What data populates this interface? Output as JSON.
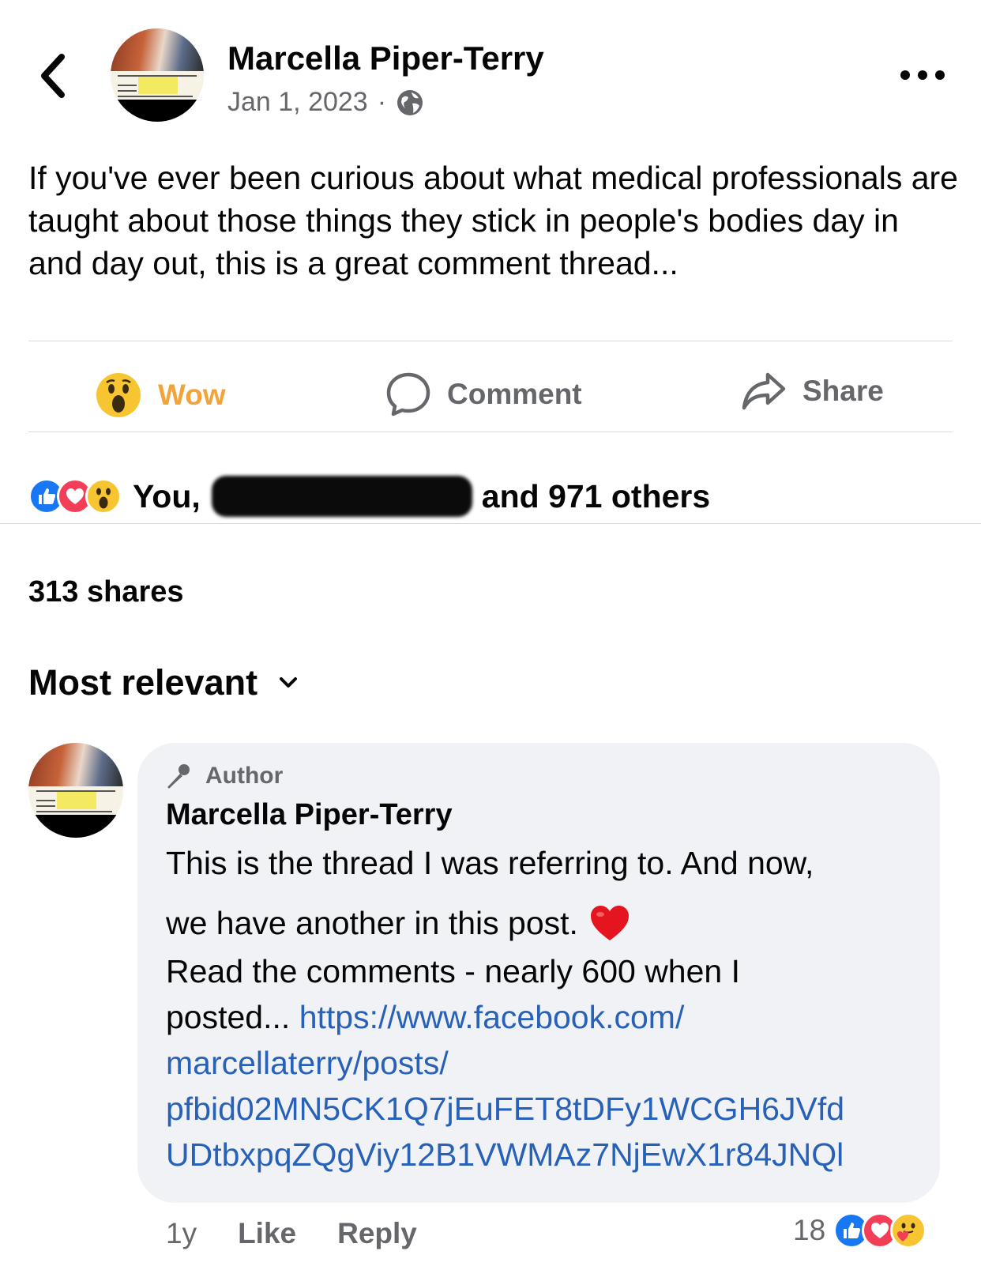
{
  "header": {
    "author_name": "Marcella Piper-Terry",
    "date": "Jan 1, 2023",
    "separator": "·",
    "privacy_icon": "globe-icon",
    "back_icon": "chevron-left-icon",
    "more_icon": "more-horizontal-icon"
  },
  "post": {
    "text": "If you've ever been curious about what medical professionals are taught about those things they stick in people's bodies day in and day out, this is a great comment thread..."
  },
  "actions": {
    "reaction_label": "Wow",
    "comment_label": "Comment",
    "share_label": "Share",
    "reaction_color": "#f0a43a"
  },
  "reactions": {
    "icons": [
      "like-icon",
      "love-icon",
      "wow-icon"
    ],
    "prefix": "You,",
    "suffix": "and 971 others"
  },
  "shares": "313 shares",
  "sort": {
    "label": "Most relevant"
  },
  "comment": {
    "badge": "Author",
    "author_name": "Marcella Piper-Terry",
    "line1": "This is the thread I was referring to. And now,",
    "line2": "we have another in this post.",
    "line3": "Read the comments - nearly 600 when I",
    "line4_text": "posted...",
    "link_line1": "https://www.facebook.com/",
    "link_line2": "marcellaterry/posts/",
    "link_line3": "pfbid02MN5CK1Q7jEuFET8tDFy1WCGH6JVfd",
    "link_line4": "UDtbxpqZQgViy12B1VWMAz7NjEwX1r84JNQl",
    "time": "1y",
    "like_label": "Like",
    "reply_label": "Reply",
    "reaction_count": "18",
    "reaction_icons": [
      "like-icon",
      "love-icon",
      "care-icon"
    ]
  },
  "colors": {
    "link": "#2761b8",
    "like_blue": "#1877f2",
    "love_red": "#f33e58",
    "secondary_text": "#65676b",
    "bubble_bg": "#f0f2f5"
  }
}
